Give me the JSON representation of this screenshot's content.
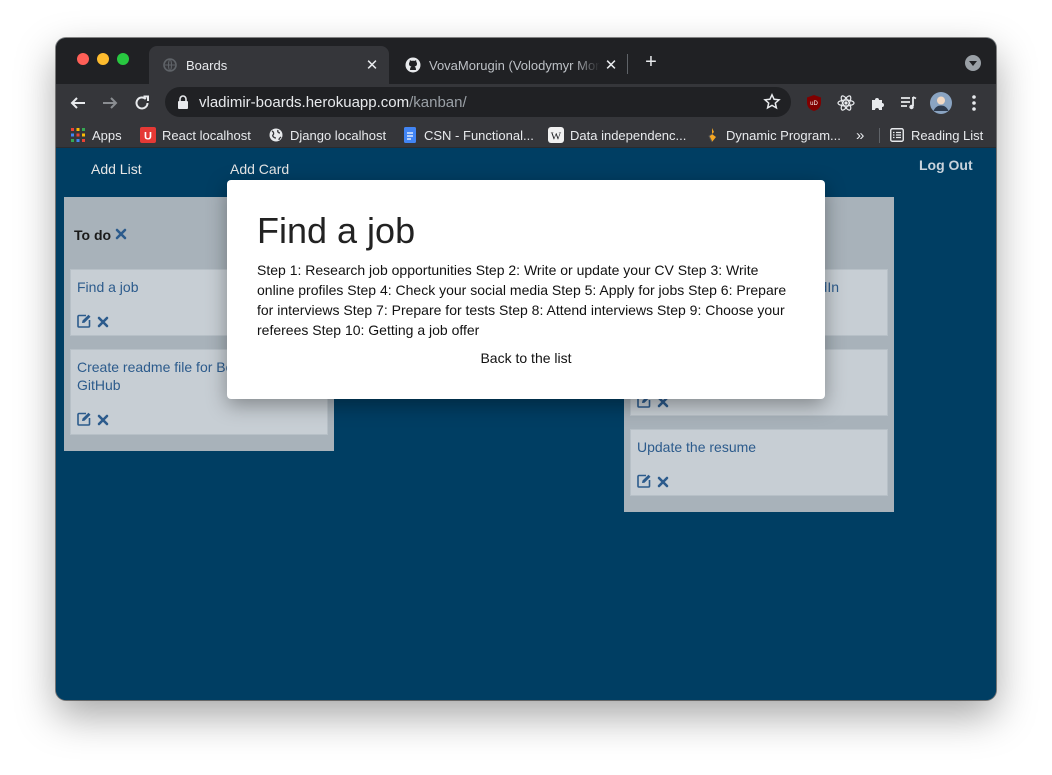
{
  "browser": {
    "tabs": [
      {
        "title": "Boards",
        "active": true
      },
      {
        "title": "VovaMorugin (Volodymyr Morugin)",
        "active": false
      }
    ],
    "url_host": "vladimir-boards.herokuapp.com",
    "url_path": "/kanban/",
    "bookmarks": [
      {
        "label": "Apps",
        "icon": "apps-grid-icon"
      },
      {
        "label": "React localhost",
        "icon": "react-u-icon"
      },
      {
        "label": "Django localhost",
        "icon": "globe-icon"
      },
      {
        "label": "CSN - Functional...",
        "icon": "docs-icon"
      },
      {
        "label": "Data independenc...",
        "icon": "wikipedia-icon"
      },
      {
        "label": "Dynamic Program...",
        "icon": "dynamic-programming-icon"
      }
    ],
    "overflow_label": "»",
    "reading_list": "Reading List"
  },
  "app": {
    "nav": {
      "add_list": "Add List",
      "add_card": "Add Card",
      "log_out": "Log Out"
    },
    "lists": [
      {
        "title": "To do",
        "cards": [
          {
            "text": "Find a job"
          },
          {
            "text": "Create readme file for Boards on GitHub"
          }
        ]
      },
      {
        "title": "",
        "cards": [
          {
            "text": "Update LinkedIn"
          },
          {
            "text": ""
          },
          {
            "text": "Update the resume"
          }
        ]
      }
    ],
    "modal": {
      "title": "Find a job",
      "body": "Step 1: Research job opportunities Step 2: Write or update your CV Step 3: Write online profiles Step 4: Check your social media Step 5: Apply for jobs Step 6: Prepare for interviews Step 7: Prepare for tests Step 8: Attend interviews Step 9: Choose your referees Step 10: Getting a job offer",
      "back": "Back to the list"
    }
  }
}
